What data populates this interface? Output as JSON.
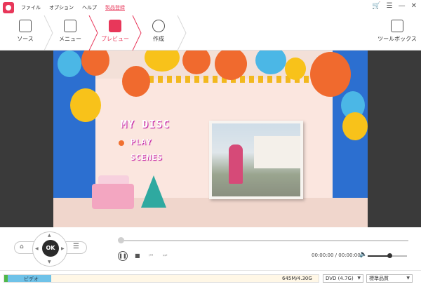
{
  "titlebar": {
    "menu": [
      "ファイル",
      "オプション",
      "ヘルプ",
      "製品登録"
    ]
  },
  "toolbar": {
    "steps": [
      {
        "label": "ソース",
        "icon": "source-document-icon"
      },
      {
        "label": "メニュー",
        "icon": "menu-image-icon"
      },
      {
        "label": "プレビュー",
        "icon": "preview-play-icon"
      },
      {
        "label": "作成",
        "icon": "burn-disc-icon"
      }
    ],
    "tools_label": "ツールボックス"
  },
  "preview": {
    "menu_title": "MY DISC",
    "menu_items": [
      "PLAY",
      "SCENES"
    ]
  },
  "controls": {
    "ok_label": "OK",
    "time": "00:00:00 / 00:00:00",
    "volume_level": 0.55
  },
  "status": {
    "capacity_label": "ビデオ",
    "capacity_text": "645M/4.30G",
    "capacity_fraction": 0.15,
    "disc_type": "DVD (4.7G)",
    "quality": "標準品質"
  },
  "colors": {
    "accent": "#e8375a",
    "wall": "#2c6fd0"
  }
}
